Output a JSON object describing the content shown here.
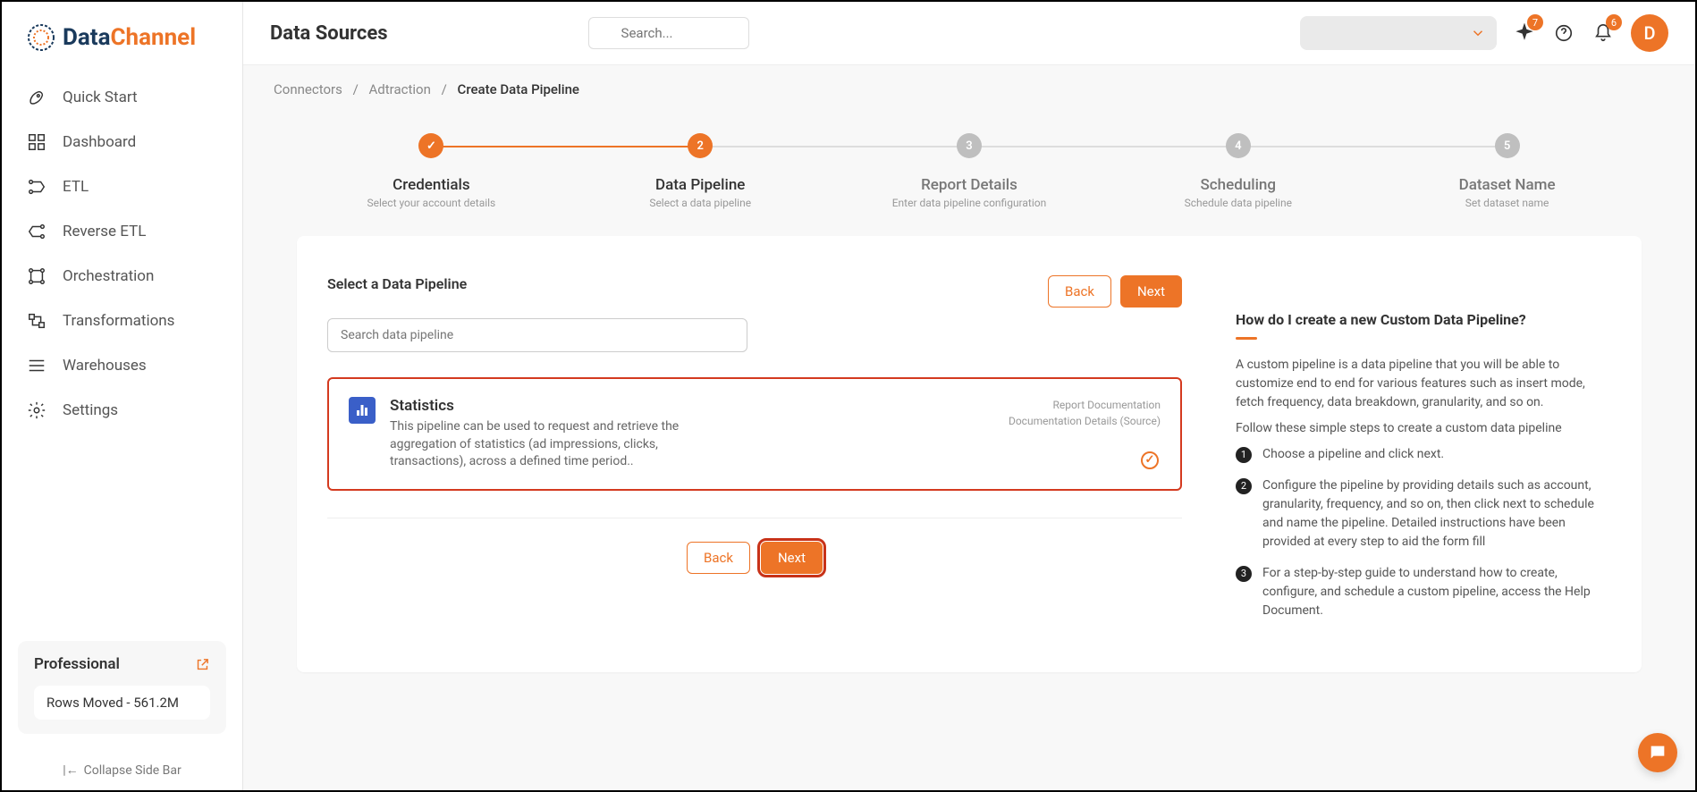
{
  "brand": {
    "first": "Data",
    "second": "Channel"
  },
  "sidebar": {
    "items": [
      {
        "label": "Quick Start"
      },
      {
        "label": "Dashboard"
      },
      {
        "label": "ETL"
      },
      {
        "label": "Reverse ETL"
      },
      {
        "label": "Orchestration"
      },
      {
        "label": "Transformations"
      },
      {
        "label": "Warehouses"
      },
      {
        "label": "Settings"
      }
    ],
    "plan_name": "Professional",
    "rows_moved": "Rows Moved - 561.2M",
    "collapse": "Collapse Side Bar"
  },
  "header": {
    "title": "Data Sources",
    "search_placeholder": "Search...",
    "spark_badge": "7",
    "bell_badge": "6",
    "avatar_initial": "D"
  },
  "breadcrumbs": {
    "a": "Connectors",
    "b": "Adtraction",
    "c": "Create Data Pipeline"
  },
  "stepper": [
    {
      "title": "Credentials",
      "sub": "Select your account details",
      "state": "done",
      "mark": "✓"
    },
    {
      "title": "Data Pipeline",
      "sub": "Select a data pipeline",
      "state": "active",
      "mark": "2"
    },
    {
      "title": "Report Details",
      "sub": "Enter data pipeline configuration",
      "state": "pending",
      "mark": "3"
    },
    {
      "title": "Scheduling",
      "sub": "Schedule data pipeline",
      "state": "pending",
      "mark": "4"
    },
    {
      "title": "Dataset Name",
      "sub": "Set dataset name",
      "state": "pending",
      "mark": "5"
    }
  ],
  "pipeline": {
    "section_title": "Select a Data Pipeline",
    "search_placeholder": "Search data pipeline",
    "card_title": "Statistics",
    "card_desc": "This pipeline can be used to request and retrieve the aggregation of statistics (ad impressions, clicks, transactions), across a defined time period..",
    "link1": "Report Documentation",
    "link2": "Documentation Details (Source)",
    "back": "Back",
    "next": "Next"
  },
  "help": {
    "title": "How do I create a new Custom Data Pipeline?",
    "p1": "A custom pipeline is a data pipeline that you will be able to customize end to end for various features such as insert mode, fetch frequency, data breakdown, granularity, and so on.",
    "p2": "Follow these simple steps to create a custom data pipeline",
    "steps": [
      "Choose a pipeline and click next.",
      "Configure the pipeline by providing details such as account, granularity, frequency, and so on, then click next to schedule and name the pipeline. Detailed instructions have been provided at every step to aid the form fill",
      "For a step-by-step guide to understand how to create, configure, and schedule a custom pipeline, access the Help Document."
    ]
  }
}
